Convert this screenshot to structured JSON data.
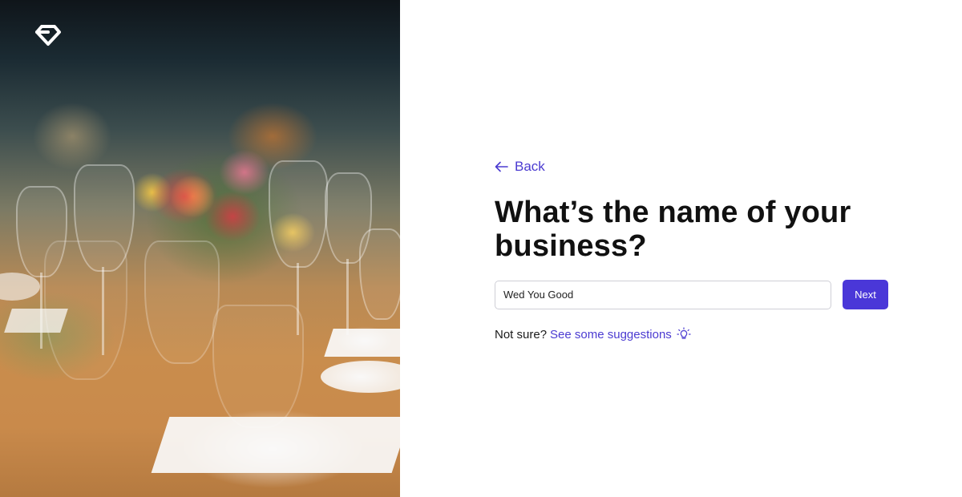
{
  "brand": {
    "logo_icon": "diamond-logo-icon"
  },
  "photo": {
    "description_icon": "wedding-table-photo"
  },
  "form": {
    "back_label": "Back",
    "back_icon": "arrow-left-icon",
    "title": "What’s the name of your business?",
    "business_name_value": "Wed You Good",
    "next_label": "Next",
    "not_sure_text": "Not sure?",
    "suggestions_link": "See some suggestions",
    "suggestions_icon": "lightbulb-icon"
  },
  "colors": {
    "accent": "#4a37d8",
    "link": "#4b3bd1",
    "title": "#111111"
  }
}
